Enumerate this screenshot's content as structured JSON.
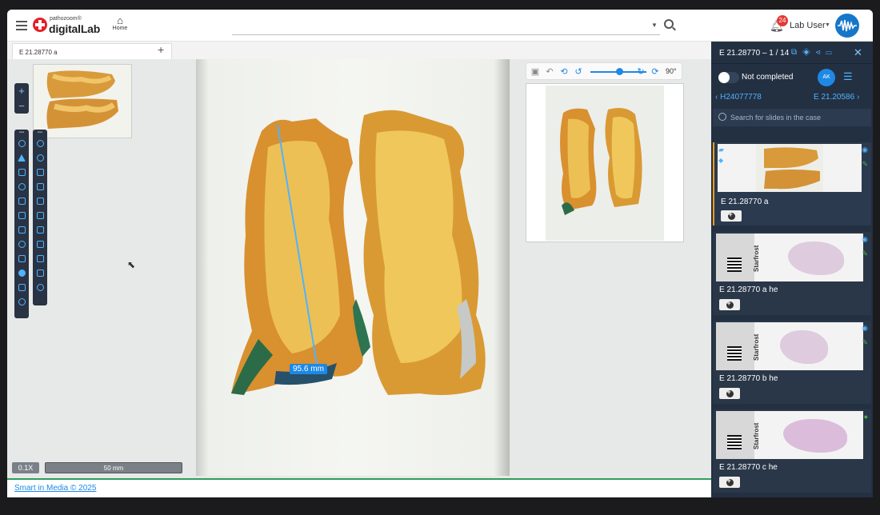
{
  "header": {
    "logo_small": "pathozoom®",
    "logo_big": "digitalLab",
    "home_label": "Home",
    "search_placeholder": "",
    "notification_count": "24",
    "user_name": "Lab User"
  },
  "tabs": [
    {
      "label": "E 21.28770 a"
    }
  ],
  "viewer": {
    "measurement": "95.6 mm",
    "zoom_level": "0.1X",
    "scale_label": "50 mm",
    "rotation": "90°"
  },
  "panel": {
    "title": "E 21.28770 – 1 / 14",
    "status": "Not completed",
    "initials": "AK",
    "prev_case": "H24077778",
    "next_case": "E 21.20586",
    "search_placeholder": "Search for slides in the case",
    "slides": [
      {
        "name": "E 21.28770 a"
      },
      {
        "name": "E 21.28770 a he"
      },
      {
        "name": "E 21.28770 b he"
      },
      {
        "name": "E 21.28770 c he"
      }
    ],
    "label_text": "Starfrost"
  },
  "footer": {
    "copyright": "Smart in Media © 2025"
  },
  "colors": {
    "accent": "#1e88e5",
    "panel_bg": "#233042",
    "active_marker": "#f29e1b",
    "footer_line": "#2e9c5d"
  }
}
